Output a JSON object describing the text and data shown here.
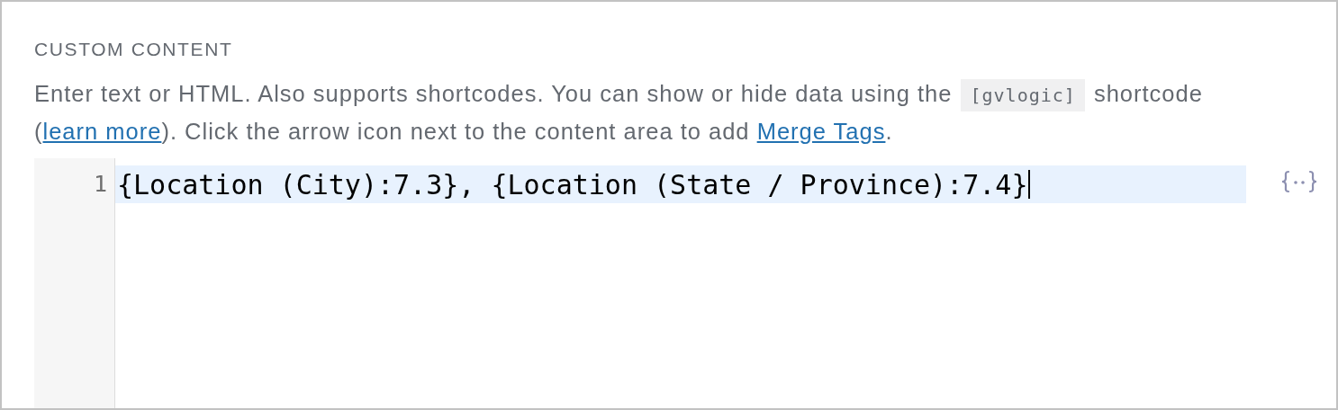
{
  "section": {
    "heading": "CUSTOM CONTENT",
    "description": [
      {
        "kind": "text",
        "text": "Enter text or HTML. Also supports shortcodes. You can show or hide data using the "
      },
      {
        "kind": "code",
        "text": "[gvlogic]"
      },
      {
        "kind": "text",
        "text": " shortcode ("
      },
      {
        "kind": "link",
        "text": "learn more"
      },
      {
        "kind": "text",
        "text": "). Click the arrow icon next to the content area to add "
      },
      {
        "kind": "link",
        "text": "Merge Tags"
      },
      {
        "kind": "text",
        "text": "."
      }
    ],
    "editor": {
      "lines": [
        {
          "number": "1",
          "text": "{Location (City):7.3}, {Location (State / Province):7.4}",
          "active": true,
          "cursor": true
        }
      ]
    }
  }
}
